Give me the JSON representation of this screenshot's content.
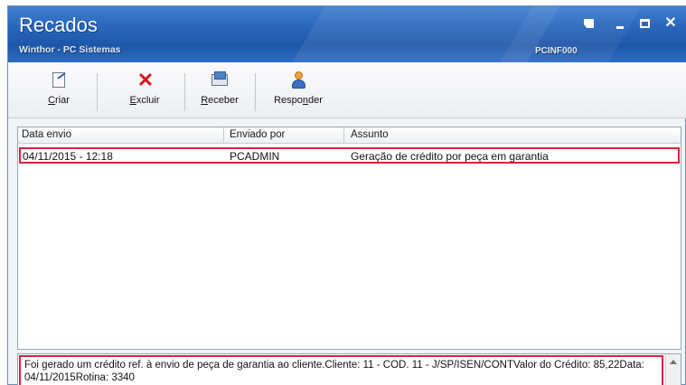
{
  "window": {
    "title": "Recados",
    "subtitle": "Winthor - PC Sistemas",
    "code": "PCINF000",
    "controls": {
      "restore_glyph": "",
      "minimize_glyph": "",
      "maximize_glyph": "",
      "close_glyph": "✕"
    }
  },
  "toolbar": {
    "buttons": [
      {
        "key": "C",
        "rest": "riar",
        "icon": "new-message-icon"
      },
      {
        "key": "E",
        "rest": "xcluir",
        "icon": "delete-icon"
      },
      {
        "key": "R",
        "rest": "eceber",
        "icon": "receive-mail-icon"
      },
      {
        "pre": "Respo",
        "key": "n",
        "rest": "der",
        "icon": "person-icon"
      }
    ]
  },
  "list": {
    "columns": [
      "Data envio",
      "Enviado por",
      "Assunto"
    ],
    "rows": [
      {
        "data_envio": "04/11/2015 - 12:18",
        "enviado_por": "PCADMIN",
        "assunto": "Geração de crédito por peça em garantia"
      }
    ]
  },
  "detail": {
    "text": "Foi gerado um crédito ref. à envio de peça de garantia ao cliente.Cliente: 11 - COD. 11 - J/SP/ISEN/CONTValor do Crédito: 85,22Data: 04/11/2015Rotina: 3340"
  },
  "colors": {
    "titlebar": "#2a67bd",
    "highlight_border": "#e0213c",
    "delete_icon": "#d11a1a"
  }
}
